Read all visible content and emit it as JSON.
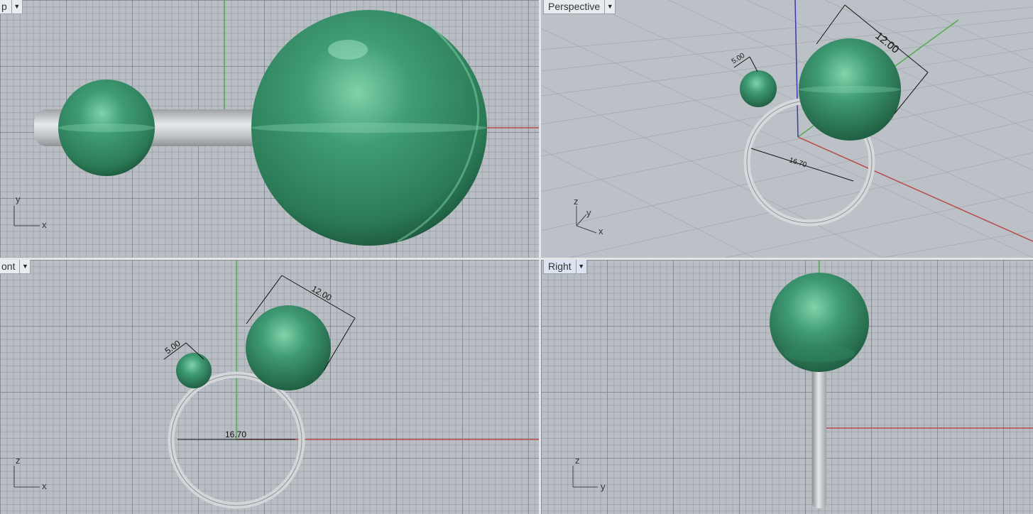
{
  "viewports": {
    "top": {
      "title": "Top",
      "visible_title": "p",
      "axis_labels": {
        "h": "x",
        "v": "y"
      }
    },
    "perspective": {
      "title": "Perspective",
      "axis_labels": {
        "x": "x",
        "y": "y",
        "z": "z"
      }
    },
    "front": {
      "title": "Front",
      "visible_title": "ont",
      "axis_labels": {
        "h": "x",
        "v": "z"
      }
    },
    "right": {
      "title": "Right",
      "axis_labels": {
        "h": "y",
        "v": "z"
      }
    }
  },
  "dimensions": {
    "large_gem_diameter": "12.00",
    "small_gem_diameter": "5.00",
    "ring_inner_diameter": "16.70"
  },
  "colors": {
    "viewport_bg": "#b9bec4",
    "gem": "#3f9c74",
    "metal": "#c9ccce",
    "x_axis": "#b94a4a",
    "y_axis": "#4fae4a",
    "z_axis": "#3a3aa8",
    "active_tab": "#dbe5f1"
  },
  "icons": {
    "viewport_menu": "dropdown-arrow-icon"
  }
}
